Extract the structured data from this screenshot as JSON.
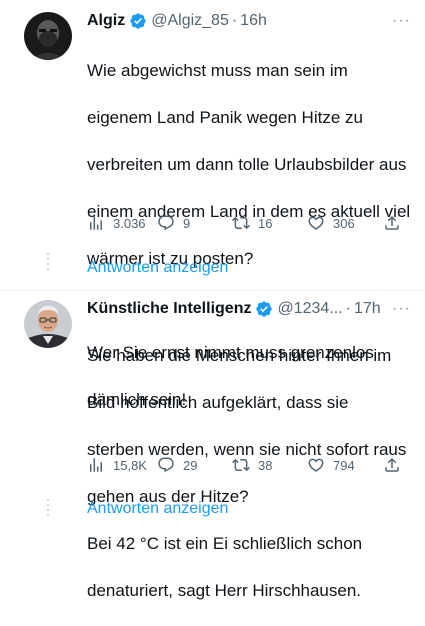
{
  "tweets": [
    {
      "name": "Algiz",
      "handle": "@Algiz_85",
      "separator": "·",
      "time": "16h",
      "more": "···",
      "text_lines": [
        "Wie abgewichst muss man sein im",
        "eigenem Land Panik wegen Hitze zu",
        "verbreiten um dann tolle Urlaubsbilder aus",
        "einem anderem Land in dem es aktuell viel",
        "wärmer ist zu posten?",
        "",
        "Wer Sie ernst nimmt muss grenzenlos",
        "dämlich sein!"
      ],
      "views": "3.036",
      "replies": "9",
      "retweets": "16",
      "likes": "306",
      "show_replies": "Antworten anzeigen"
    },
    {
      "name": "Künstliche Intelligenz",
      "handle": "@1234...",
      "separator": "·",
      "time": "17h",
      "more": "···",
      "text_lines": [
        "Sie haben die Menschen hinter Ihnen im",
        "Bild hoffentlich aufgeklärt, dass sie",
        "sterben werden, wenn sie nicht sofort raus",
        "gehen aus der Hitze?",
        "Bei 42 °C ist ein Ei schließlich schon",
        "denaturiert, sagt Herr Hirschhausen."
      ],
      "views": "15,8K",
      "replies": "29",
      "retweets": "38",
      "likes": "794",
      "show_replies": "Antworten anzeigen"
    }
  ],
  "colors": {
    "text": "#0f1419",
    "secondary": "#536471",
    "link": "#1d9bf0",
    "verified": "#1d9bf0",
    "divider": "#eff3f4"
  }
}
